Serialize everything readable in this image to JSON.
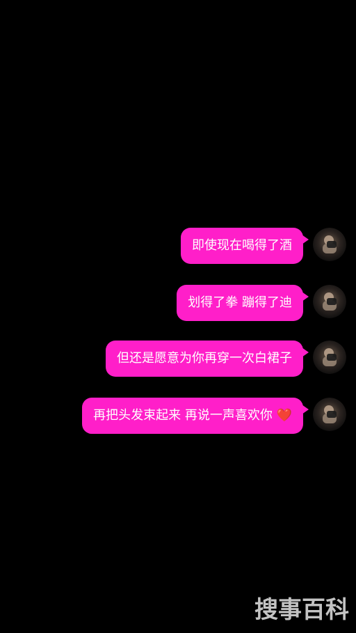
{
  "messages": [
    {
      "text": "即使现在喝得了酒"
    },
    {
      "text": "划得了拳 蹦得了迪"
    },
    {
      "text": "但还是愿意为你再穿一次白裙子"
    },
    {
      "text": "再把头发束起来 再说一声喜欢你",
      "emoji": "❤️"
    }
  ],
  "watermark": "搜事百科",
  "colors": {
    "background": "#000000",
    "bubble": "#ff1fc9",
    "text": "#ffffff"
  },
  "icons": {
    "avatar": "avatar"
  }
}
